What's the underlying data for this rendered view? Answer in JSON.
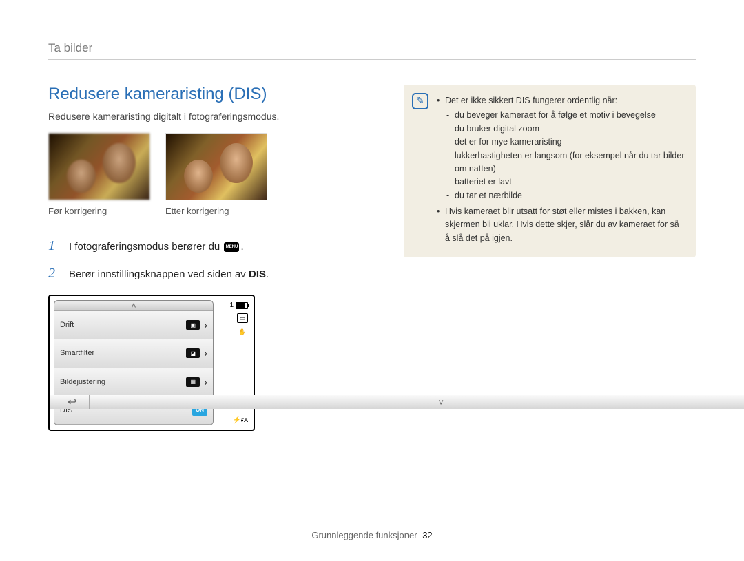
{
  "breadcrumb": "Ta bilder",
  "heading": "Redusere kameraristing (DIS)",
  "subtitle": "Redusere kameraristing digitalt i fotograferingsmodus.",
  "captions": {
    "before": "Før korrigering",
    "after": "Etter korrigering"
  },
  "steps": [
    {
      "num": "1",
      "pre": "I fotograferingsmodus berører du ",
      "chip": "MENU",
      "post": "."
    },
    {
      "num": "2",
      "pre": "Berør innstillingsknappen ved siden av ",
      "bold": "DIS",
      "post": "."
    }
  ],
  "camera_menu": {
    "battery_count": "1",
    "items": [
      {
        "label": "Drift",
        "icon": "▣",
        "chevron": true
      },
      {
        "label": "Smartfilter",
        "icon": "◪",
        "chevron": true
      },
      {
        "label": "Bildejustering",
        "icon": "▦",
        "chevron": true
      },
      {
        "label": "DIS",
        "on": "ON"
      }
    ],
    "back": "↩",
    "footer_chevron": "˅",
    "header_chevron": "˄",
    "fa_label": "ғᴀ"
  },
  "note": {
    "items": [
      {
        "text": "Det er ikke sikkert DIS fungerer ordentlig når:",
        "sub": [
          "du beveger kameraet for å følge et motiv i bevegelse",
          "du bruker digital zoom",
          "det er for mye kameraristing",
          "lukkerhastigheten er langsom (for eksempel når du tar bilder om natten)",
          "batteriet er lavt",
          "du tar et nærbilde"
        ]
      },
      {
        "text": "Hvis kameraet blir utsatt for støt eller mistes i bakken, kan skjermen bli uklar. Hvis dette skjer, slår du av kameraet for så å slå det på igjen."
      }
    ]
  },
  "footer": {
    "section": "Grunnleggende funksjoner",
    "page": "32"
  }
}
